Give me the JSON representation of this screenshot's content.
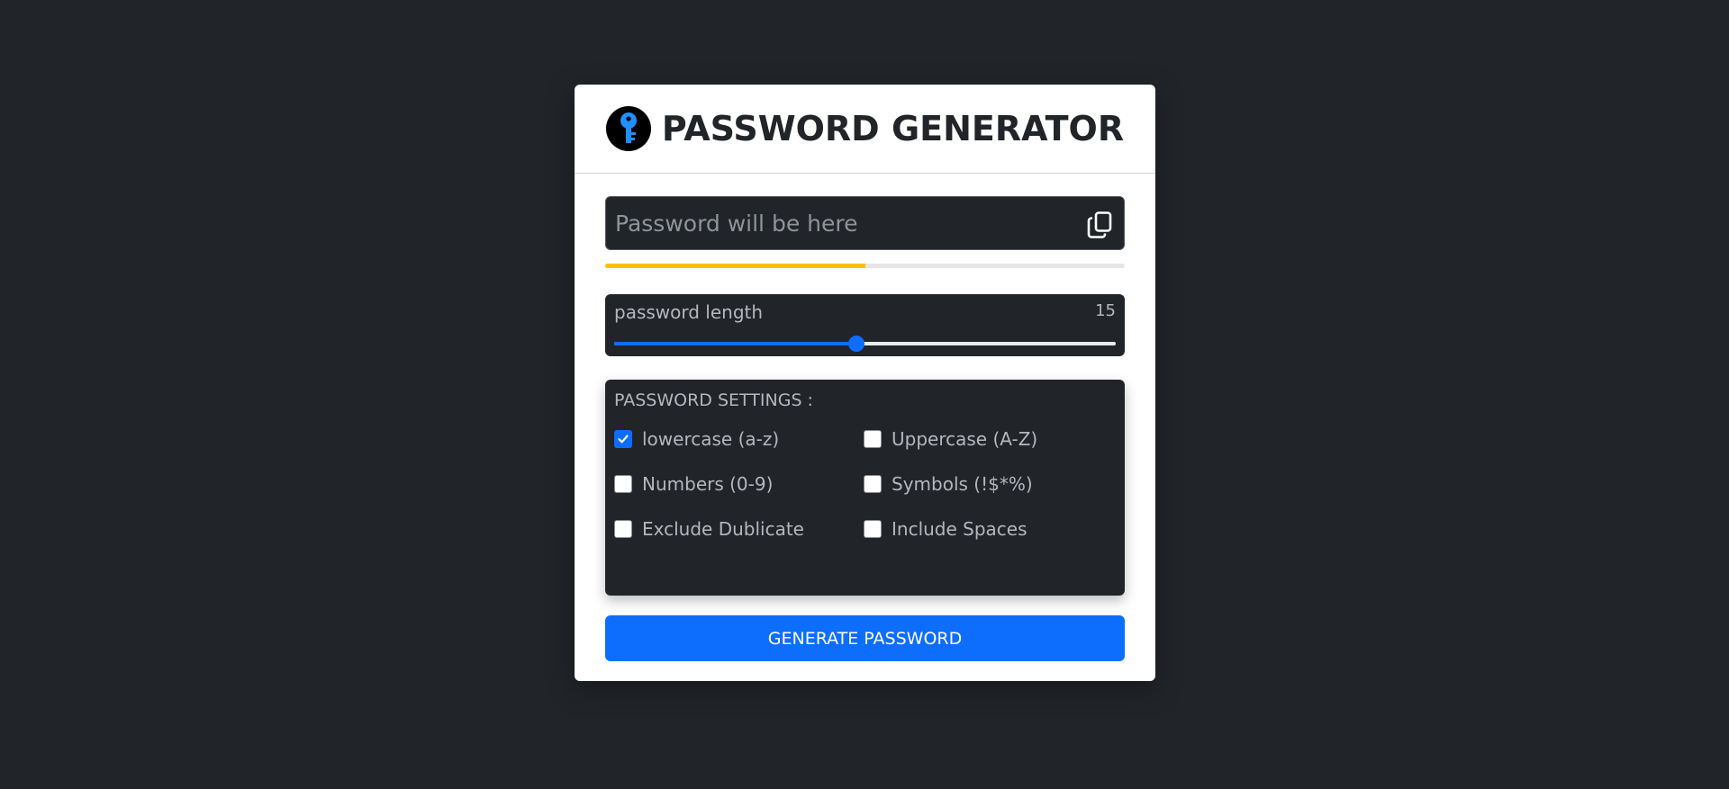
{
  "app": {
    "title": "PASSWORD GENERATOR",
    "logo_icon": "key-icon"
  },
  "password": {
    "value": "",
    "placeholder": "Password will be here",
    "copy_icon": "copy-icon",
    "strength_fraction": 0.5,
    "strength_color": "#ffc107"
  },
  "length": {
    "label": "password length",
    "value": "15",
    "min": 1,
    "max": 30
  },
  "settings": {
    "title": "PASSWORD SETTINGS :",
    "options": [
      {
        "label": "lowercase (a-z)",
        "checked": true
      },
      {
        "label": "Uppercase (A-Z)",
        "checked": false
      },
      {
        "label": "Numbers (0-9)",
        "checked": false
      },
      {
        "label": "Symbols (!$*%)",
        "checked": false
      },
      {
        "label": "Exclude Dublicate",
        "checked": false
      },
      {
        "label": "Include Spaces",
        "checked": false
      }
    ]
  },
  "actions": {
    "generate_label": "GENERATE PASSWORD"
  },
  "colors": {
    "background": "#212429",
    "accent": "#0d6efd",
    "card": "#ffffff"
  }
}
